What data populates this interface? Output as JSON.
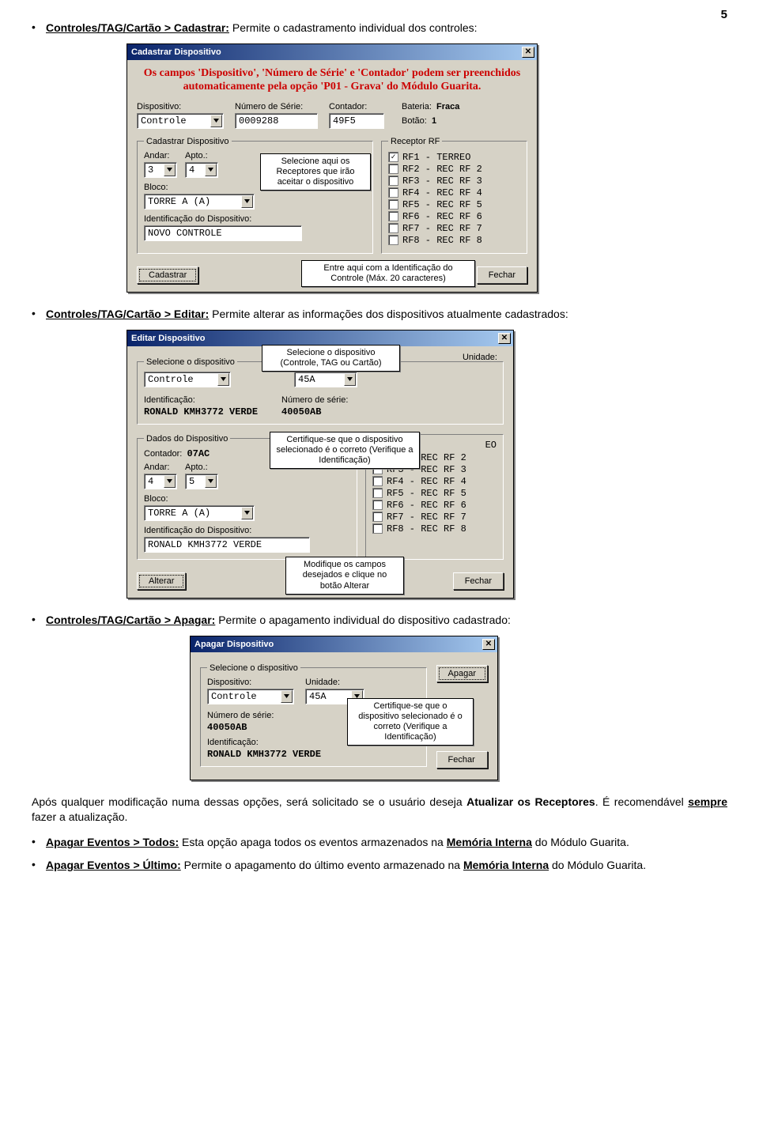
{
  "page_number": "5",
  "bullets": {
    "cadastrar": {
      "head": "Controles/TAG/Cartão > Cadastrar:",
      "text": " Permite o cadastramento individual dos controles:"
    },
    "editar": {
      "head": "Controles/TAG/Cartão > Editar:",
      "text": " Permite alterar as informações dos dispositivos atualmente cadastrados:"
    },
    "apagar": {
      "head": "Controles/TAG/Cartão > Apagar:",
      "text": " Permite o apagamento individual do dispositivo cadastrado:"
    },
    "eventos_todos": {
      "head": "Apagar Eventos > Todos:",
      "text_before": " Esta opção apaga todos os eventos armazenados na ",
      "bold": "Memória Interna",
      "text_after": " do Módulo Guarita."
    },
    "eventos_ultimo": {
      "head": "Apagar Eventos > Último:",
      "text_before": " Permite o apagamento do último evento armazenado na ",
      "bold": "Memória Interna",
      "text_after": " do Módulo Guarita."
    }
  },
  "after_paragraph": {
    "p1a": "Após qualquer modificação numa dessas opções, será solicitado se o usuário deseja ",
    "p1b": "Atualizar os Receptores",
    "p1c": ". É recomendável ",
    "p1d": "sempre",
    "p1e": " fazer a atualização."
  },
  "dlg_cadastrar": {
    "title": "Cadastrar Dispositivo",
    "notice": "Os campos 'Dispositivo', 'Número de Série' e 'Contador' podem ser preenchidos automaticamente pela opção 'P01 - Grava' do Módulo Guarita.",
    "labels": {
      "dispositivo": "Dispositivo:",
      "serie": "Número de Série:",
      "contador": "Contador:",
      "bateria_lbl": "Bateria:",
      "bateria_val": "Fraca",
      "botao_lbl": "Botão:",
      "botao_val": "1",
      "andar": "Andar:",
      "apto": "Apto.:",
      "bloco": "Bloco:",
      "ident": "Identificação do Dispositivo:"
    },
    "values": {
      "dispositivo": "Controle",
      "serie": "0009288",
      "contador": "49F5",
      "andar": "3",
      "apto": "4",
      "bloco": "TORRE A (A)",
      "ident": "NOVO CONTROLE"
    },
    "group_cadastrar": "Cadastrar Dispositivo",
    "group_receptor": "Receptor RF",
    "rf": [
      {
        "label": "RF1 - TERREO",
        "checked": true
      },
      {
        "label": "RF2 - REC RF 2",
        "checked": false
      },
      {
        "label": "RF3 - REC RF 3",
        "checked": false
      },
      {
        "label": "RF4 - REC RF 4",
        "checked": false
      },
      {
        "label": "RF5 - REC RF 5",
        "checked": false
      },
      {
        "label": "RF6 - REC RF 6",
        "checked": false
      },
      {
        "label": "RF7 - REC RF 7",
        "checked": false
      },
      {
        "label": "RF8 - REC RF 8",
        "checked": false
      }
    ],
    "callout_rx": "Selecione aqui os Receptores que irão aceitar o dispositivo",
    "callout_id": "Entre aqui com a Identificação do Controle (Máx. 20 caracteres)",
    "btn_ok": "Cadastrar",
    "btn_close": "Fechar"
  },
  "dlg_editar": {
    "title": "Editar Dispositivo",
    "group_sel": "Selecione o dispositivo",
    "labels": {
      "unidade": "Unidade:",
      "ident": "Identificação:",
      "serie": "Número de série:",
      "contador": "Contador:",
      "andar": "Andar:",
      "apto": "Apto.:",
      "bloco": "Bloco:",
      "ident_dev": "Identificação do Dispositivo:"
    },
    "values": {
      "dispositivo": "Controle",
      "unidade": "45A",
      "ident": "RONALD KMH3772 VERDE",
      "serie": "40050AB",
      "contador": "07AC",
      "andar": "4",
      "apto": "5",
      "bloco": "TORRE A (A)",
      "ident_dev": "RONALD KMH3772 VERDE",
      "rf1_suffix": "EO"
    },
    "group_dados": "Dados do Dispositivo",
    "rf": [
      {
        "label": "RF2 - REC RF 2",
        "checked": false
      },
      {
        "label": "RF3 - REC RF 3",
        "checked": false
      },
      {
        "label": "RF4 - REC RF 4",
        "checked": false
      },
      {
        "label": "RF5 - REC RF 5",
        "checked": false
      },
      {
        "label": "RF6 - REC RF 6",
        "checked": false
      },
      {
        "label": "RF7 - REC RF 7",
        "checked": false
      },
      {
        "label": "RF8 - REC RF 8",
        "checked": false
      }
    ],
    "callout_sel": "Selecione o dispositivo (Controle, TAG ou Cartão)",
    "callout_verify": "Certifique-se que o dispositivo selecionado é o correto (Verifique a Identificação)",
    "callout_alt": "Modifique os campos desejados e clique no botão Alterar",
    "btn_ok": "Alterar",
    "btn_close": "Fechar"
  },
  "dlg_apagar": {
    "title": "Apagar Dispositivo",
    "group_sel": "Selecione o dispositivo",
    "labels": {
      "dispositivo": "Dispositivo:",
      "unidade": "Unidade:",
      "serie": "Número de série:",
      "ident": "Identificação:"
    },
    "values": {
      "dispositivo": "Controle",
      "unidade": "45A",
      "serie": "40050AB",
      "ident": "RONALD KMH3772 VERDE"
    },
    "callout": "Certifique-se que o dispositivo selecionado é o correto (Verifique a Identificação)",
    "btn_ok": "Apagar",
    "btn_close": "Fechar"
  }
}
